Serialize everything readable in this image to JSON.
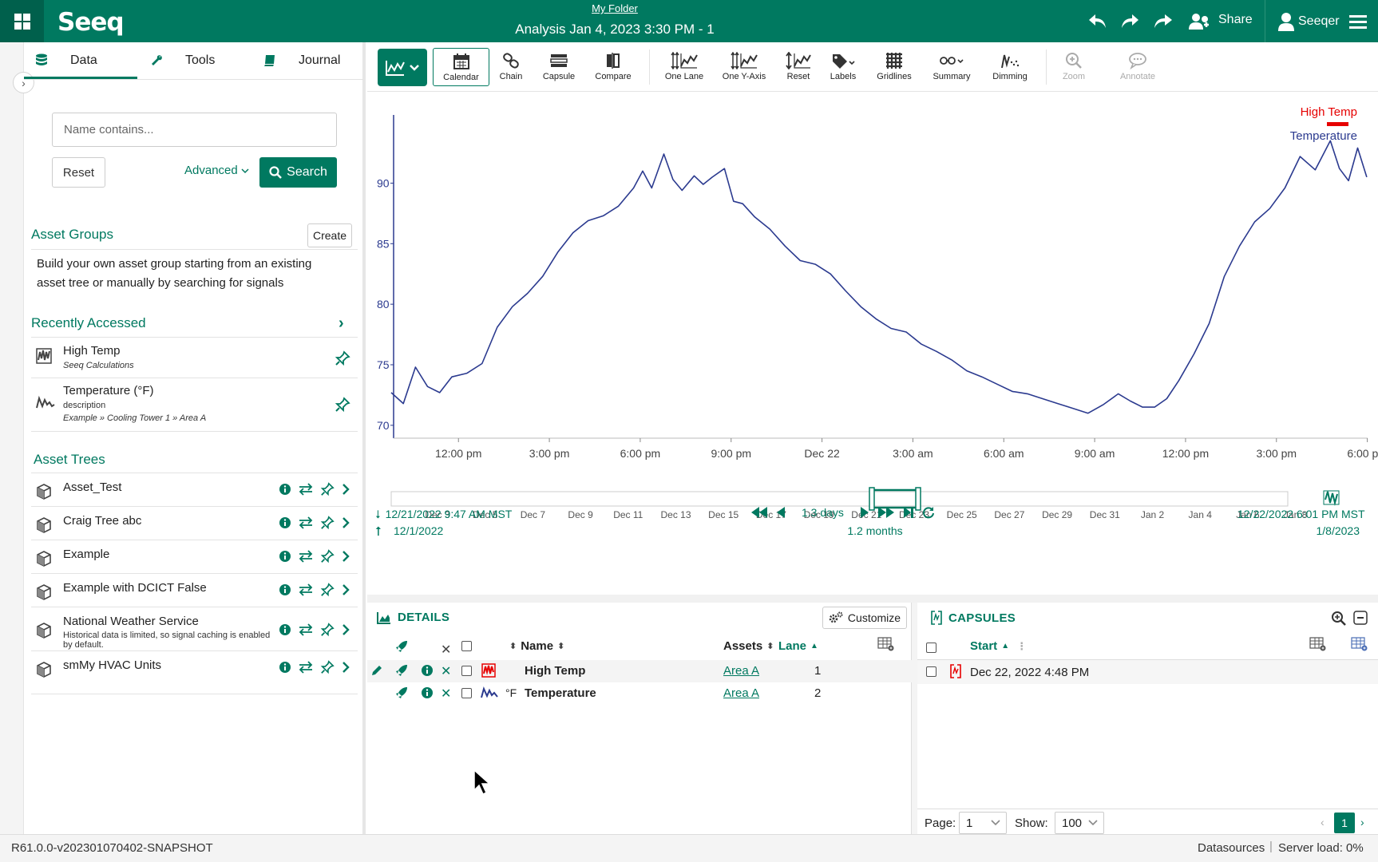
{
  "header": {
    "folder": "My Folder",
    "title": "Analysis Jan 4, 2023 3:30 PM - 1",
    "logo": "Seeq",
    "share_label": "Share",
    "user_label": "Seeqer"
  },
  "left_panel": {
    "tabs": [
      {
        "label": "Data",
        "icon": "database-icon"
      },
      {
        "label": "Tools",
        "icon": "wrench-icon"
      },
      {
        "label": "Journal",
        "icon": "book-icon"
      }
    ],
    "search": {
      "placeholder": "Name contains...",
      "reset_label": "Reset",
      "advanced_label": "Advanced",
      "search_label": "Search"
    },
    "asset_groups": {
      "title": "Asset Groups",
      "create_label": "Create",
      "description": "Build your own asset group starting from an existing asset tree or manually by searching for signals"
    },
    "recently_accessed": {
      "title": "Recently Accessed",
      "items": [
        {
          "name": "High Temp",
          "sub": "Seeq Calculations",
          "sub2": ""
        },
        {
          "name": "Temperature (°F)",
          "sub": "description",
          "sub2": "Example » Cooling Tower 1 » Area A"
        }
      ]
    },
    "asset_trees": {
      "title": "Asset Trees",
      "items": [
        {
          "name": "Asset_Test",
          "sub": ""
        },
        {
          "name": "Craig Tree abc",
          "sub": ""
        },
        {
          "name": "Example",
          "sub": ""
        },
        {
          "name": "Example with DCICT False",
          "sub": ""
        },
        {
          "name": "National Weather Service",
          "sub": "Historical data is limited, so signal caching is enabled by default."
        },
        {
          "name": "smMy HVAC Units",
          "sub": ""
        }
      ]
    }
  },
  "toolbar": {
    "buttons": [
      {
        "label": "Calendar",
        "icon": "calendar-icon"
      },
      {
        "label": "Chain",
        "icon": "chain-icon"
      },
      {
        "label": "Capsule",
        "icon": "capsule-icon"
      },
      {
        "label": "Compare",
        "icon": "compare-icon"
      },
      {
        "label": "One Lane",
        "icon": "one-lane-icon"
      },
      {
        "label": "One Y-Axis",
        "icon": "one-y-axis-icon"
      },
      {
        "label": "Reset",
        "icon": "reset-axis-icon"
      },
      {
        "label": "Labels",
        "icon": "tag-icon"
      },
      {
        "label": "Gridlines",
        "icon": "grid-icon"
      },
      {
        "label": "Summary",
        "icon": "summary-icon"
      },
      {
        "label": "Dimming",
        "icon": "dimming-icon"
      },
      {
        "label": "Zoom",
        "icon": "zoom-icon"
      },
      {
        "label": "Annotate",
        "icon": "comment-icon"
      }
    ]
  },
  "chart_data": {
    "type": "line",
    "legend": [
      "High Temp",
      "Temperature"
    ],
    "legend_colors": [
      "#e60000",
      "#2b3a8f"
    ],
    "y_ticks": [
      70,
      75,
      80,
      85,
      90
    ],
    "ylim": [
      69.2,
      95.5
    ],
    "x_ticks": [
      "12:00 pm",
      "3:00 pm",
      "6:00 pm",
      "9:00 pm",
      "Dec 22",
      "3:00 am",
      "6:00 am",
      "9:00 am",
      "12:00 pm",
      "3:00 pm",
      "6:00 pm"
    ],
    "x_hours": [
      2.22,
      5.22,
      8.22,
      11.22,
      14.22,
      17.22,
      20.22,
      23.22,
      26.22,
      29.22,
      32.22
    ],
    "xlim": [
      0,
      32.23
    ],
    "series": [
      {
        "name": "Temperature",
        "x": [
          0,
          0.4,
          0.8,
          1.2,
          1.6,
          2.0,
          2.5,
          3.0,
          3.5,
          4.0,
          4.5,
          5.0,
          5.5,
          6.0,
          6.5,
          7.0,
          7.5,
          8.0,
          8.3,
          8.6,
          9.0,
          9.3,
          9.6,
          10.0,
          10.3,
          10.6,
          11.0,
          11.3,
          11.6,
          12.0,
          12.5,
          13.0,
          13.5,
          14.0,
          14.5,
          15.0,
          15.5,
          16.0,
          16.5,
          17.0,
          17.5,
          18.0,
          18.5,
          19.0,
          19.5,
          20.0,
          20.5,
          21.0,
          21.5,
          22.0,
          22.5,
          23.0,
          23.5,
          24.0,
          24.4,
          24.8,
          25.2,
          25.6,
          26.0,
          26.5,
          27.0,
          27.5,
          28.0,
          28.5,
          29.0,
          29.5,
          30.0,
          30.5,
          31.0,
          31.3,
          31.6,
          31.9,
          32.2
        ],
        "values": [
          72.7,
          71.8,
          74.8,
          73.2,
          72.7,
          74.0,
          74.3,
          75.1,
          78.1,
          79.8,
          80.9,
          82.3,
          84.3,
          85.9,
          86.9,
          87.3,
          88.1,
          89.6,
          91.0,
          89.6,
          92.4,
          90.3,
          89.4,
          90.6,
          89.9,
          90.5,
          91.2,
          88.5,
          88.3,
          87.2,
          86.2,
          84.8,
          83.6,
          83.3,
          82.5,
          81.1,
          79.8,
          78.8,
          78.0,
          77.7,
          76.7,
          76.1,
          75.4,
          74.5,
          74.0,
          73.4,
          72.8,
          72.6,
          72.2,
          71.8,
          71.4,
          71.0,
          71.7,
          72.6,
          72.0,
          71.5,
          71.5,
          72.2,
          73.7,
          75.9,
          78.4,
          82.3,
          84.8,
          86.8,
          87.9,
          89.6,
          92.2,
          91.1,
          93.5,
          91.2,
          90.2,
          92.9,
          90.5
        ]
      }
    ],
    "nav": {
      "start": "12/21/2022 9:47 AM  MST",
      "end": "12/22/2022 6:01 PM  MST",
      "duration": "1.3 days",
      "overview_ticks": [
        "Dec 3",
        "Dec 5",
        "Dec 7",
        "Dec 9",
        "Dec 11",
        "Dec 13",
        "Dec 15",
        "Dec 17",
        "Dec 19",
        "Dec 21",
        "Dec 23",
        "Dec 25",
        "Dec 27",
        "Dec 29",
        "Dec 31",
        "Jan 2",
        "Jan 4",
        "Jan 6",
        "Jan 8"
      ],
      "overview_start": "12/1/2022",
      "overview_end": "1/8/2023",
      "overview_duration": "1.2 months"
    }
  },
  "details": {
    "title": "DETAILS",
    "customize_label": "Customize",
    "col_name": "Name",
    "col_assets": "Assets",
    "col_lane": "Lane",
    "rows": [
      {
        "name": "High Temp",
        "unit": "",
        "asset": "Area A",
        "lane": "1"
      },
      {
        "name": "Temperature",
        "unit": "°F",
        "asset": "Area A",
        "lane": "2"
      }
    ]
  },
  "capsules": {
    "title": "CAPSULES",
    "col_start": "Start",
    "rows": [
      {
        "start": "Dec 22, 2022 4:48 PM"
      }
    ],
    "page_label": "Page:",
    "page_value": "1",
    "show_label": "Show:",
    "show_value": "100",
    "current_page": "1"
  },
  "status": {
    "version": "R61.0.0-v202301070402-SNAPSHOT",
    "datasources": "Datasources",
    "server_load": "Server load: 0%"
  }
}
